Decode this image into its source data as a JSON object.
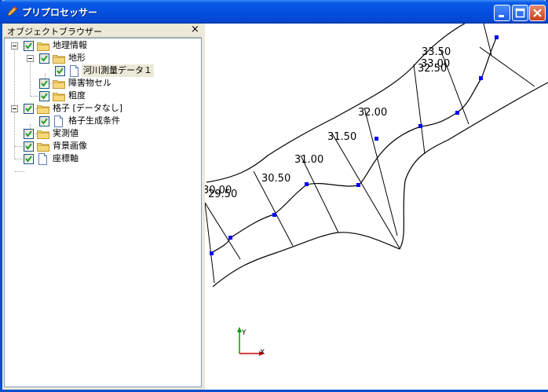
{
  "window": {
    "title": "プリプロセッサー",
    "app_icon": "pencil-icon",
    "minimize_icon": "minimize-icon",
    "maximize_icon": "maximize-icon",
    "close_icon": "close-icon"
  },
  "object_browser": {
    "title": "オブジェクトブラウザー",
    "close_glyph": "×",
    "items": [
      {
        "label": "地理情報",
        "checked": true,
        "icon": "folder-icon",
        "expanded": true
      },
      {
        "label": "地形",
        "checked": true,
        "icon": "folder-icon",
        "expanded": true
      },
      {
        "label": "河川測量データ１",
        "checked": true,
        "icon": "document-icon",
        "selected": true
      },
      {
        "label": "障害物セル",
        "checked": true,
        "icon": "folder-icon"
      },
      {
        "label": "粗度",
        "checked": true,
        "icon": "folder-icon"
      },
      {
        "label": "格子 [データなし]",
        "checked": true,
        "icon": "folder-icon",
        "expanded": true
      },
      {
        "label": "格子生成条件",
        "checked": true,
        "icon": "document-icon"
      },
      {
        "label": "実測値",
        "checked": true,
        "icon": "folder-icon"
      },
      {
        "label": "背景画像",
        "checked": true,
        "icon": "folder-icon"
      },
      {
        "label": "座標軸",
        "checked": true,
        "icon": "document-icon"
      }
    ]
  },
  "canvas": {
    "cross_section_labels": [
      "30.00",
      "29.50",
      "30.50",
      "31.00",
      "31.50",
      "32.00",
      "32.50",
      "33.00",
      "33.50"
    ],
    "axis": {
      "y_label": "Y",
      "x_label": "X"
    },
    "colors": {
      "river_line": "#000000",
      "center_points": "#0000ff",
      "axis_x": "#cc0000",
      "axis_y": "#00a000"
    }
  }
}
